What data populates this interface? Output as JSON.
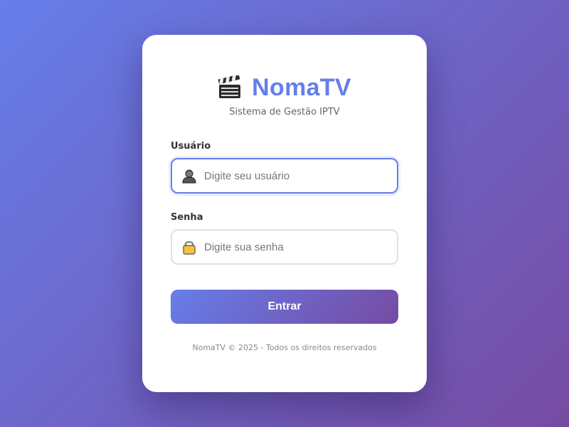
{
  "brand": {
    "name": "NomaTV",
    "subtitle": "Sistema de Gestão IPTV",
    "logo_icon": "clapper-board-icon"
  },
  "form": {
    "username": {
      "label": "Usuário",
      "placeholder": "Digite seu usuário",
      "value": "",
      "icon": "user-icon",
      "focused": true
    },
    "password": {
      "label": "Senha",
      "placeholder": "Digite sua senha",
      "value": "",
      "icon": "lock-icon"
    },
    "submit_label": "Entrar"
  },
  "footer": {
    "text": "NomaTV © 2025 - Todos os direitos reservados"
  },
  "colors": {
    "accent": "#667eea",
    "gradient_end": "#764ba2",
    "text_dark": "#333333",
    "text_muted": "#888888"
  }
}
